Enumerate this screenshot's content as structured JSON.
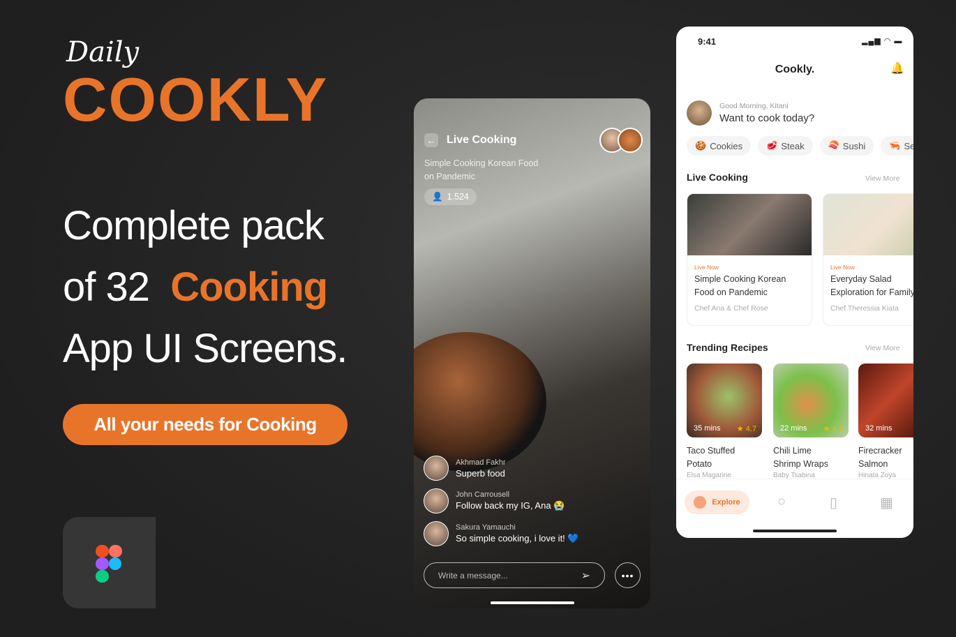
{
  "promo": {
    "script_word": "Daily",
    "brand": "COOKLY",
    "headline": [
      "Complete pack",
      "of 32",
      "Cooking",
      "App UI Screens."
    ],
    "cta": "All your needs for Cooking",
    "accent": "#E8742A"
  },
  "live": {
    "title": "Live Cooking",
    "subtitle": "Simple Cooking Korean Food on Pandemic",
    "viewers": "1.524",
    "comments": [
      {
        "name": "Akhmad Fakhr",
        "text": "Superb food"
      },
      {
        "name": "John Carrousell",
        "text": "Follow back my IG, Ana 😭"
      },
      {
        "name": "Sakura Yamauchi",
        "text": "So simple cooking, i love it! 💙"
      }
    ],
    "message_placeholder": "Write a message...",
    "more": "•••"
  },
  "app": {
    "time": "9:41",
    "title": "Cookly.",
    "greeting": "Good Morning, Kitani",
    "question": "Want to cook today?",
    "chips": [
      {
        "icon": "🍪",
        "label": "Cookies"
      },
      {
        "icon": "🥩",
        "label": "Steak"
      },
      {
        "icon": "🍣",
        "label": "Sushi"
      },
      {
        "icon": "🦐",
        "label": "Seafood"
      }
    ],
    "live_section": "Live Cooking",
    "view_more": "View More",
    "live_cards": [
      {
        "badge": "Live Now",
        "title1": "Simple Cooking Korean",
        "title2": "Food on Pandemic",
        "chef": "Chef Ana & Chef Rose"
      },
      {
        "badge": "Live Now",
        "title1": "Everyday Salad",
        "title2": "Exploration for Family",
        "chef": "Chef Theressia Kiata"
      }
    ],
    "trending_section": "Trending Recipes",
    "recipes": [
      {
        "time": "35 mins",
        "rating": "★ 4.7",
        "name1": "Taco Stuffed",
        "name2": "Potato",
        "author": "Elsa Magarine"
      },
      {
        "time": "22 mins",
        "rating": "★ 4.6",
        "name1": "Chili Lime",
        "name2": "Shrimp Wraps",
        "author": "Baby Tsabina"
      },
      {
        "time": "32 mins",
        "rating": "★",
        "name1": "Firecracker",
        "name2": "Salmon",
        "author": "Hinata Zoya"
      }
    ],
    "nav": {
      "explore": "Explore"
    }
  }
}
